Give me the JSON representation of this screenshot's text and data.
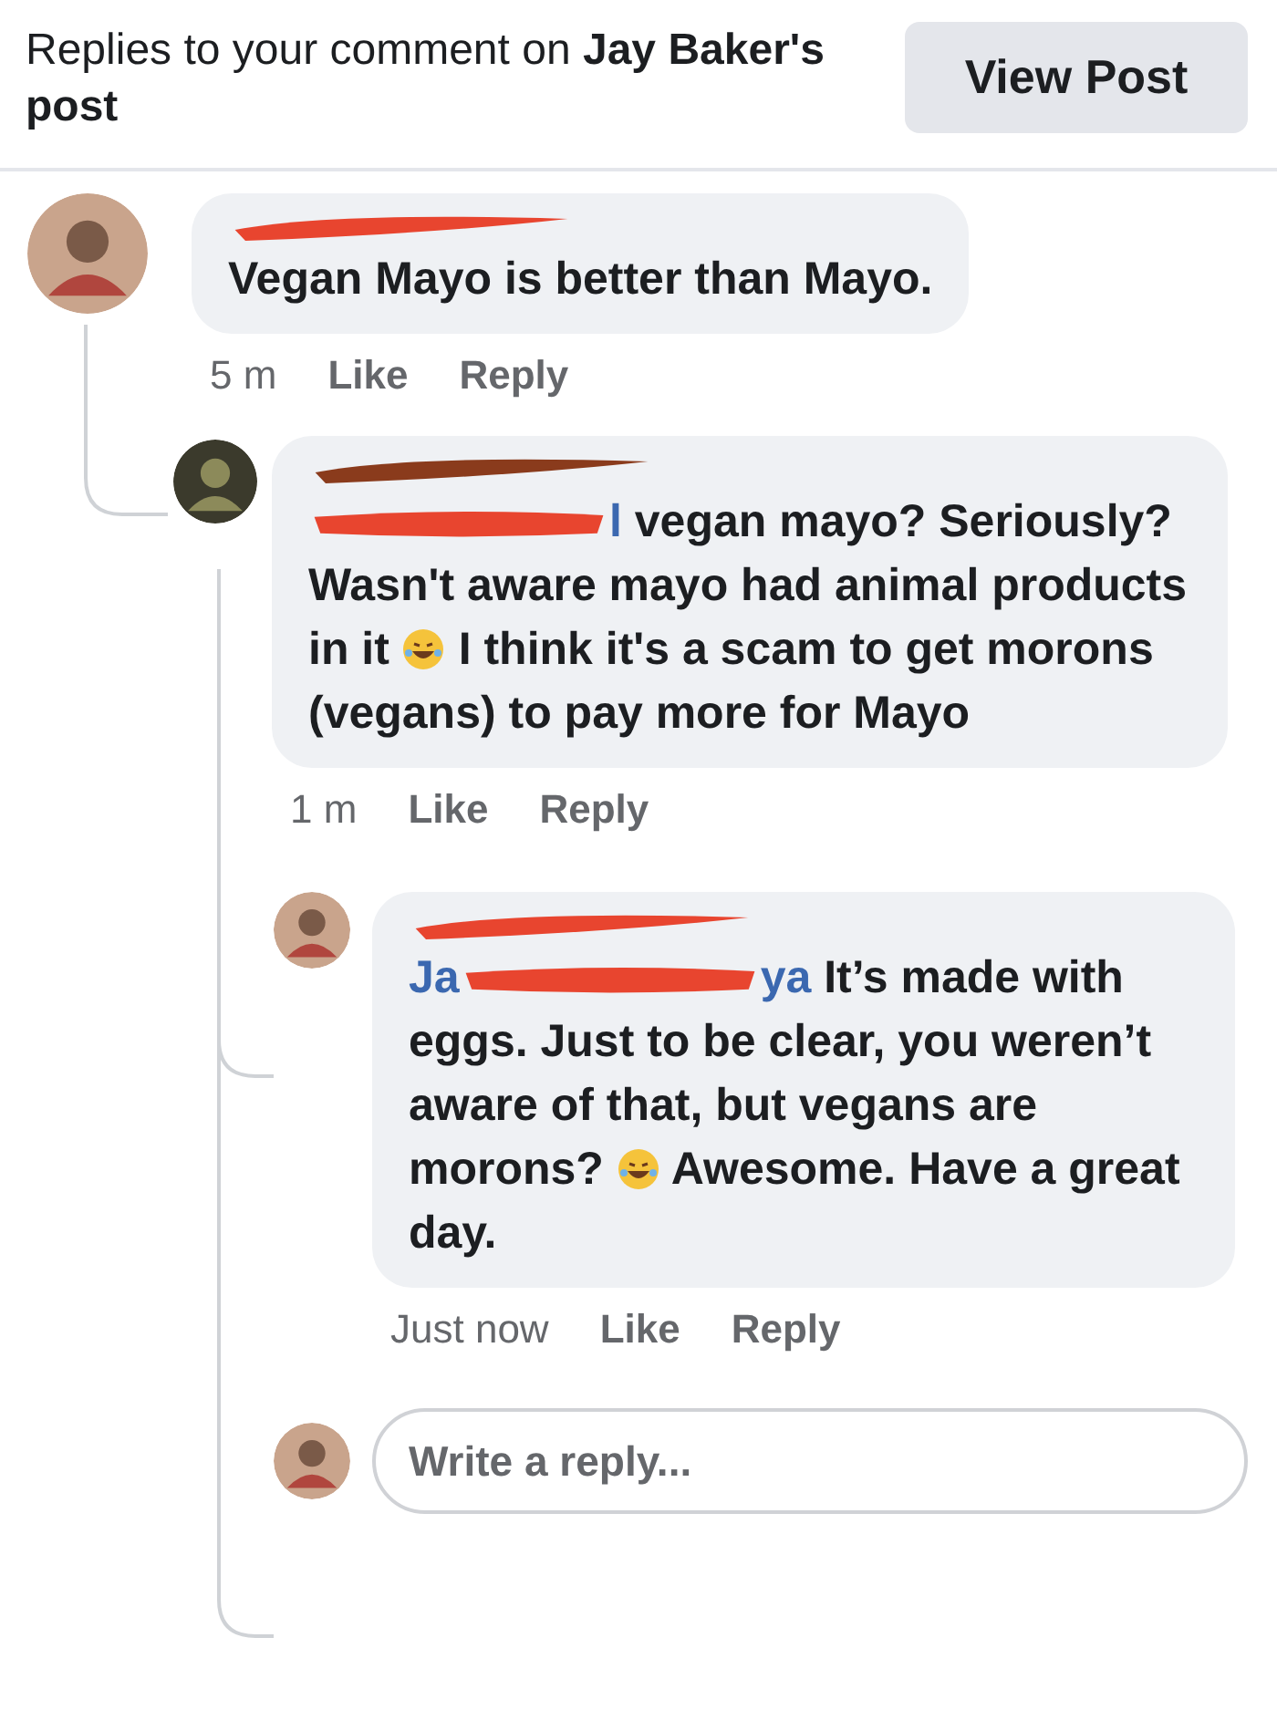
{
  "header": {
    "title": "Replies to your comment on **Jay Baker's post**",
    "button": "View Post"
  },
  "comments": [
    {
      "body": [
        {
          "kind": "text",
          "text": "Vegan Mayo is better than Mayo."
        }
      ],
      "time": "5 m",
      "like": "Like",
      "reply": "Reply",
      "children": [
        {
          "body": [
            {
              "kind": "redaction"
            },
            {
              "kind": "mention",
              "text": "l"
            },
            {
              "kind": "text",
              "text": " vegan mayo? Seriously? Wasn't aware mayo had animal products in it "
            },
            {
              "kind": "emoji"
            },
            {
              "kind": "text",
              "text": " I think it's a scam to get morons (vegans) to pay more for Mayo"
            }
          ],
          "time": "1 m",
          "like": "Like",
          "reply": "Reply",
          "children": [
            {
              "body": [
                {
                  "kind": "mention",
                  "text": "Ja"
                },
                {
                  "kind": "redaction"
                },
                {
                  "kind": "mention",
                  "text": "ya"
                },
                {
                  "kind": "text",
                  "text": " It’s made with eggs. Just to be clear, you weren’t aware of that, but vegans are morons? "
                },
                {
                  "kind": "emoji"
                },
                {
                  "kind": "text",
                  "text": " Awesome. Have a great day."
                }
              ],
              "time": "Just now",
              "like": "Like",
              "reply": "Reply"
            }
          ]
        }
      ]
    }
  ],
  "reply_field": {
    "placeholder": "Write a reply..."
  }
}
